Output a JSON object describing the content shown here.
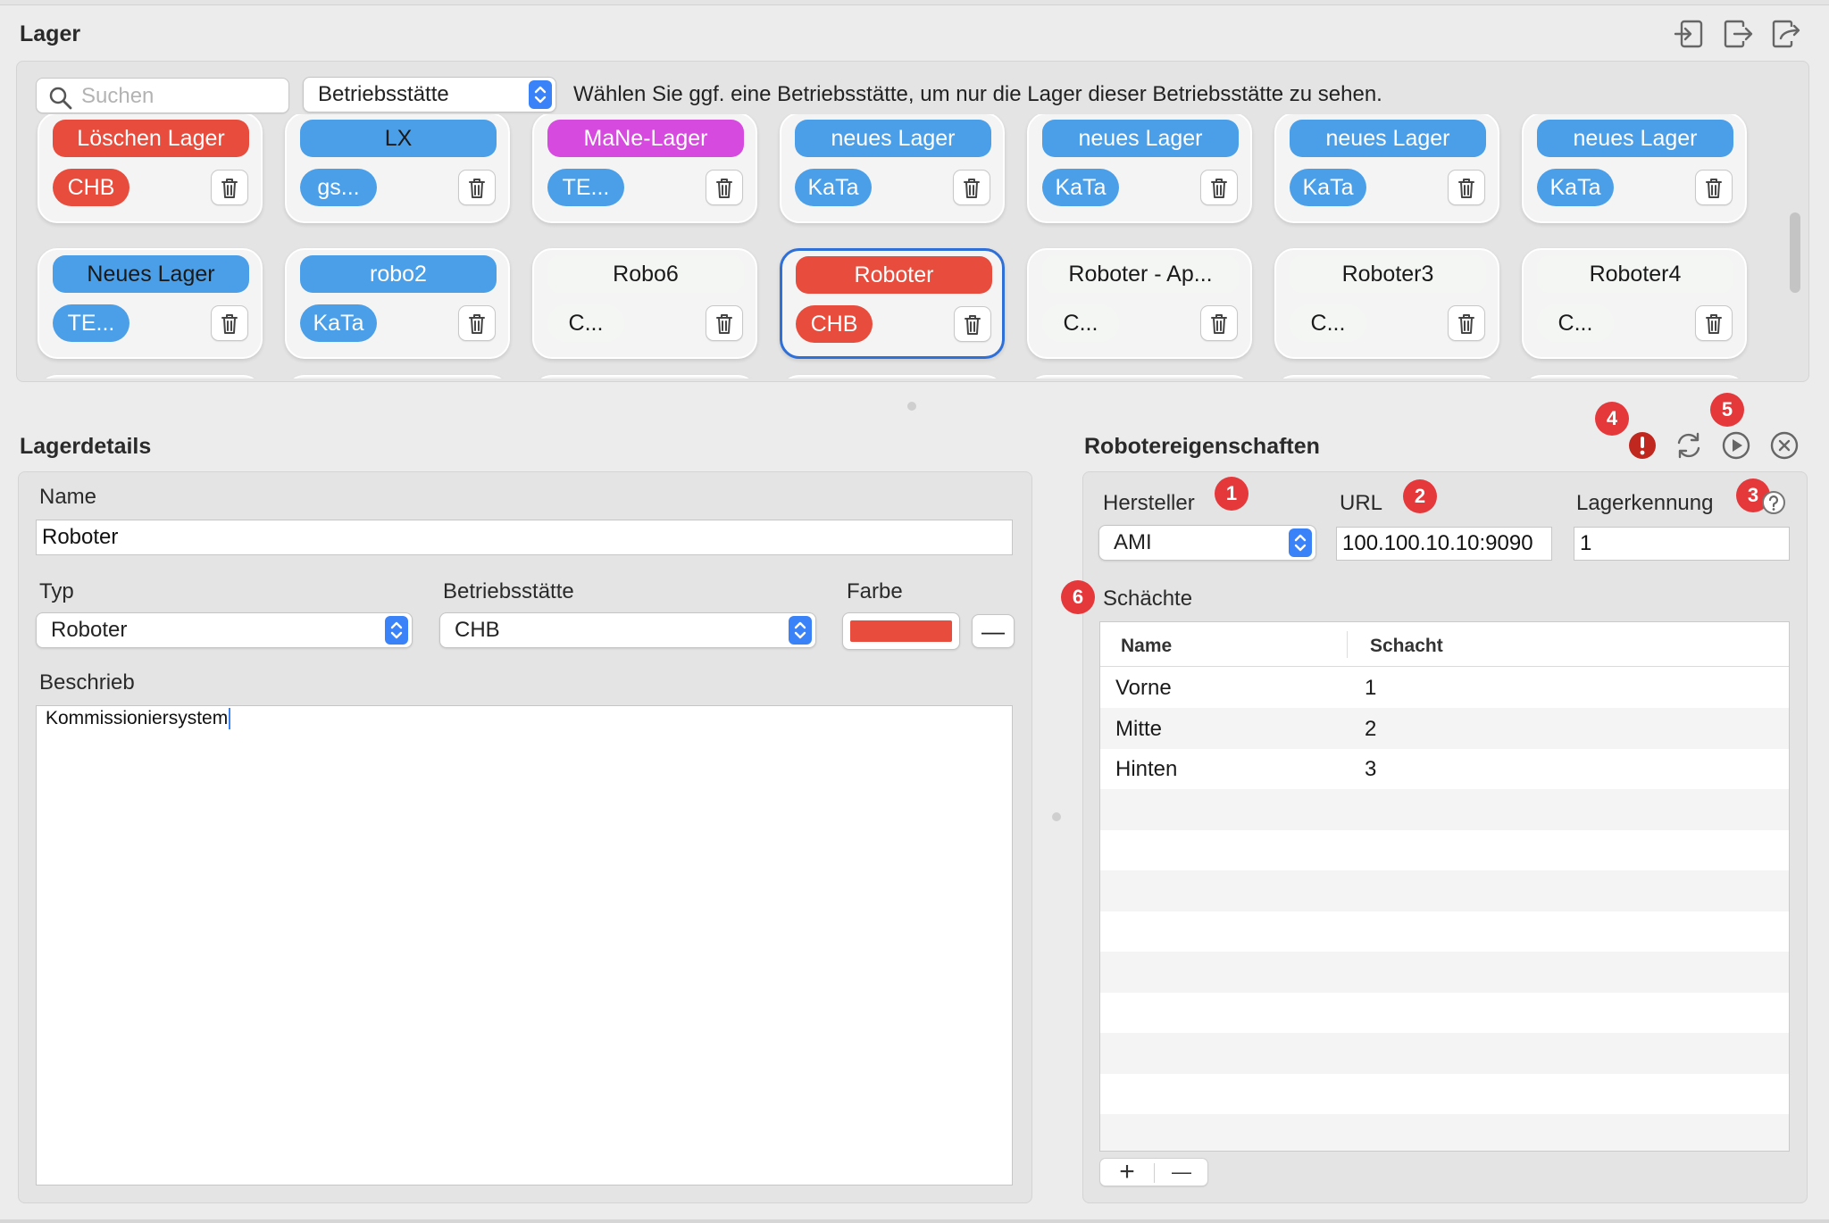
{
  "lager": {
    "title": "Lager",
    "header_icons": [
      "sign-in-icon",
      "sign-out-icon",
      "export-icon"
    ],
    "search": {
      "placeholder": "Suchen",
      "value": ""
    },
    "betriebsstaette_popup": "Betriebsstätte",
    "hint": "Wählen Sie ggf. eine Betriebsstätte, um nur die Lager dieser Betriebsstätte zu sehen.",
    "cards": [
      {
        "name": "Löschen Lager",
        "name_bg": "#e74c3c",
        "name_fg": "#ffffff",
        "tag": "CHB",
        "tag_bg": "#e74c3c",
        "tag_fg": "#ffffff",
        "selected": false
      },
      {
        "name": "LX",
        "name_bg": "#4a9fe8",
        "name_fg": "#1a1a1a",
        "tag": "gs...",
        "tag_bg": "#4a9fe8",
        "tag_fg": "#ffffff",
        "selected": false
      },
      {
        "name": "MaNe-Lager",
        "name_bg": "#d64ae0",
        "name_fg": "#ffffff",
        "tag": "TE...",
        "tag_bg": "#4a9fe8",
        "tag_fg": "#ffffff",
        "selected": false
      },
      {
        "name": "neues Lager",
        "name_bg": "#4a9fe8",
        "name_fg": "#ffffff",
        "tag": "KaTa",
        "tag_bg": "#4a9fe8",
        "tag_fg": "#ffffff",
        "selected": false
      },
      {
        "name": "neues Lager",
        "name_bg": "#4a9fe8",
        "name_fg": "#ffffff",
        "tag": "KaTa",
        "tag_bg": "#4a9fe8",
        "tag_fg": "#ffffff",
        "selected": false
      },
      {
        "name": "neues Lager",
        "name_bg": "#4a9fe8",
        "name_fg": "#ffffff",
        "tag": "KaTa",
        "tag_bg": "#4a9fe8",
        "tag_fg": "#ffffff",
        "selected": false
      },
      {
        "name": "neues Lager",
        "name_bg": "#4a9fe8",
        "name_fg": "#ffffff",
        "tag": "KaTa",
        "tag_bg": "#4a9fe8",
        "tag_fg": "#ffffff",
        "selected": false
      },
      {
        "name": "Neues Lager",
        "name_bg": "#4a9fe8",
        "name_fg": "#1a1a1a",
        "tag": "TE...",
        "tag_bg": "#4a9fe8",
        "tag_fg": "#ffffff",
        "selected": false
      },
      {
        "name": "robo2",
        "name_bg": "#4a9fe8",
        "name_fg": "#ffffff",
        "tag": "KaTa",
        "tag_bg": "#4a9fe8",
        "tag_fg": "#ffffff",
        "selected": false
      },
      {
        "name": "Robo6",
        "name_bg": "#f4f6f4",
        "name_fg": "#1a1a1a",
        "tag": "C...",
        "tag_bg": "#f4f6f4",
        "tag_fg": "#1a1a1a",
        "selected": false
      },
      {
        "name": "Roboter",
        "name_bg": "#e74c3c",
        "name_fg": "#ffffff",
        "tag": "CHB",
        "tag_bg": "#e74c3c",
        "tag_fg": "#ffffff",
        "selected": true
      },
      {
        "name": "Roboter - Ap...",
        "name_bg": "#f4f6f4",
        "name_fg": "#1a1a1a",
        "tag": "C...",
        "tag_bg": "#f4f6f4",
        "tag_fg": "#1a1a1a",
        "selected": false
      },
      {
        "name": "Roboter3",
        "name_bg": "#f4f6f4",
        "name_fg": "#1a1a1a",
        "tag": "C...",
        "tag_bg": "#f4f6f4",
        "tag_fg": "#1a1a1a",
        "selected": false
      },
      {
        "name": "Roboter4",
        "name_bg": "#f4f6f4",
        "name_fg": "#1a1a1a",
        "tag": "C...",
        "tag_bg": "#f4f6f4",
        "tag_fg": "#1a1a1a",
        "selected": false
      }
    ]
  },
  "lagerdetails": {
    "title": "Lagerdetails",
    "name_label": "Name",
    "name_value": "Roboter",
    "typ_label": "Typ",
    "typ_value": "Roboter",
    "betriebsstaette_label": "Betriebsstätte",
    "betriebsstaette_value": "CHB",
    "farbe_label": "Farbe",
    "farbe_color": "#e74c3c",
    "remove_color_label": "—",
    "beschrieb_label": "Beschrieb",
    "beschrieb_value": "Kommissioniersystem"
  },
  "robotereigenschaften": {
    "title": "Robotereigenschaften",
    "callouts": {
      "c1": "1",
      "c2": "2",
      "c3": "3",
      "c4": "4",
      "c5": "5",
      "c6": "6"
    },
    "header_icons": [
      "error-icon",
      "refresh-icon",
      "play-icon",
      "close-icon"
    ],
    "error_color": "#c0271f",
    "hersteller_label": "Hersteller",
    "hersteller_value": "AMI",
    "url_label": "URL",
    "url_value": "100.100.10.10:9090",
    "lagerkennung_label": "Lagerkennung",
    "lagerkennung_value": "1",
    "schaechte_label": "Schächte",
    "table": {
      "columns": [
        "Name",
        "Schacht"
      ],
      "rows": [
        {
          "name": "Vorne",
          "schacht": "1"
        },
        {
          "name": "Mitte",
          "schacht": "2"
        },
        {
          "name": "Hinten",
          "schacht": "3"
        }
      ]
    },
    "add_label": "+",
    "remove_label": "—"
  }
}
